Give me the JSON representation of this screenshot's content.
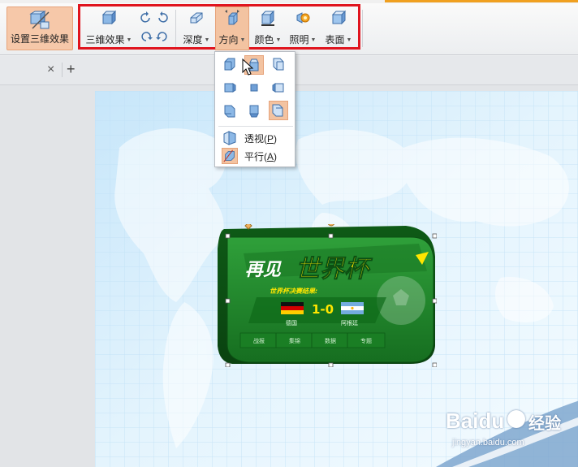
{
  "ribbon": {
    "set_3d_label": "设置三维效果",
    "effects_label": "三维效果",
    "depth_label": "深度",
    "direction_label": "方向",
    "color_label": "颜色",
    "lighting_label": "照明",
    "surface_label": "表面"
  },
  "tabs": {
    "close_glyph": "×",
    "add_glyph": "+"
  },
  "direction_menu": {
    "perspective_label": "透视",
    "perspective_key": "P",
    "parallel_label": "平行",
    "parallel_key": "A"
  },
  "slide": {
    "banner_title_part1": "再见",
    "banner_title_part2": "世界杯",
    "banner_subtitle": "世界杯决赛结果:",
    "score": "1-0",
    "team_left": "德国",
    "team_right": "阿根廷",
    "tabs": [
      "战报",
      "集锦",
      "数据",
      "专题"
    ]
  },
  "watermark": {
    "brand": "Baidu",
    "sub": "经验",
    "url": "jingyan.baidu.com"
  },
  "colors": {
    "accent_orange": "#f3c3a1",
    "highlight_red": "#e0141e",
    "banner_green": "#1f8a2a",
    "title_yellow": "#ffe600"
  }
}
